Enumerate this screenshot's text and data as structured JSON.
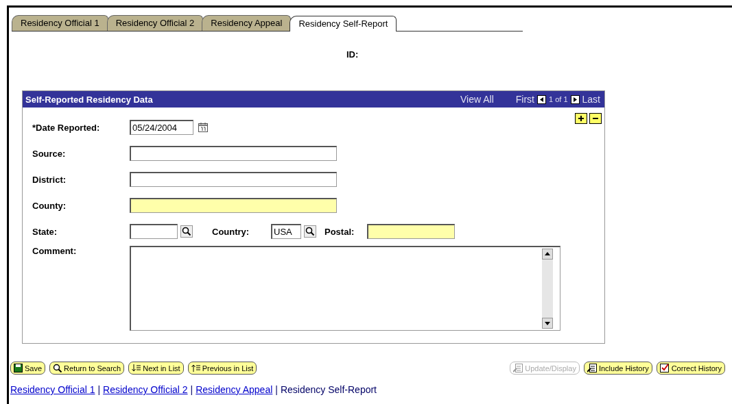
{
  "tabs": [
    {
      "label": "Residency Official 1",
      "selected": false
    },
    {
      "label": "Residency Official 2",
      "selected": false
    },
    {
      "label": "Residency Appeal",
      "selected": false
    },
    {
      "label": "Residency Self-Report",
      "selected": true
    }
  ],
  "id_label": "ID:",
  "panel": {
    "title": "Self-Reported Residency Data",
    "view_all": "View All",
    "first": "First",
    "count": "1 of 1",
    "last": "Last",
    "date": {
      "label": "*Date Reported:",
      "value": "05/24/2004"
    },
    "fields": [
      {
        "label": "Source:",
        "highlighted": false
      },
      {
        "label": "District:",
        "highlighted": false
      },
      {
        "label": "County:",
        "highlighted": true
      }
    ],
    "state": {
      "label": "State:"
    },
    "country": {
      "label": "Country:",
      "value": "USA"
    },
    "postal": {
      "label": "Postal:",
      "highlighted": true
    },
    "comment": {
      "label": "Comment:"
    }
  },
  "buttons_left": [
    {
      "label": "Save",
      "kind": "save",
      "disabled": false
    },
    {
      "label": "Return to Search",
      "kind": "search",
      "disabled": false
    },
    {
      "label": "Next in List",
      "kind": "next",
      "disabled": false
    },
    {
      "label": "Previous in List",
      "kind": "prev",
      "disabled": false
    }
  ],
  "buttons_right": [
    {
      "label": "Update/Display",
      "kind": "update",
      "disabled": true
    },
    {
      "label": "Include History",
      "kind": "update",
      "disabled": false
    },
    {
      "label": "Correct History",
      "kind": "correct",
      "disabled": false
    }
  ],
  "footer_separator": "|",
  "footer_links": [
    {
      "label": "Residency Official 1",
      "selected": false
    },
    {
      "label": "Residency Official 2",
      "selected": false
    },
    {
      "label": "Residency Appeal",
      "selected": false
    },
    {
      "label": "Residency Self-Report",
      "selected": true
    }
  ]
}
